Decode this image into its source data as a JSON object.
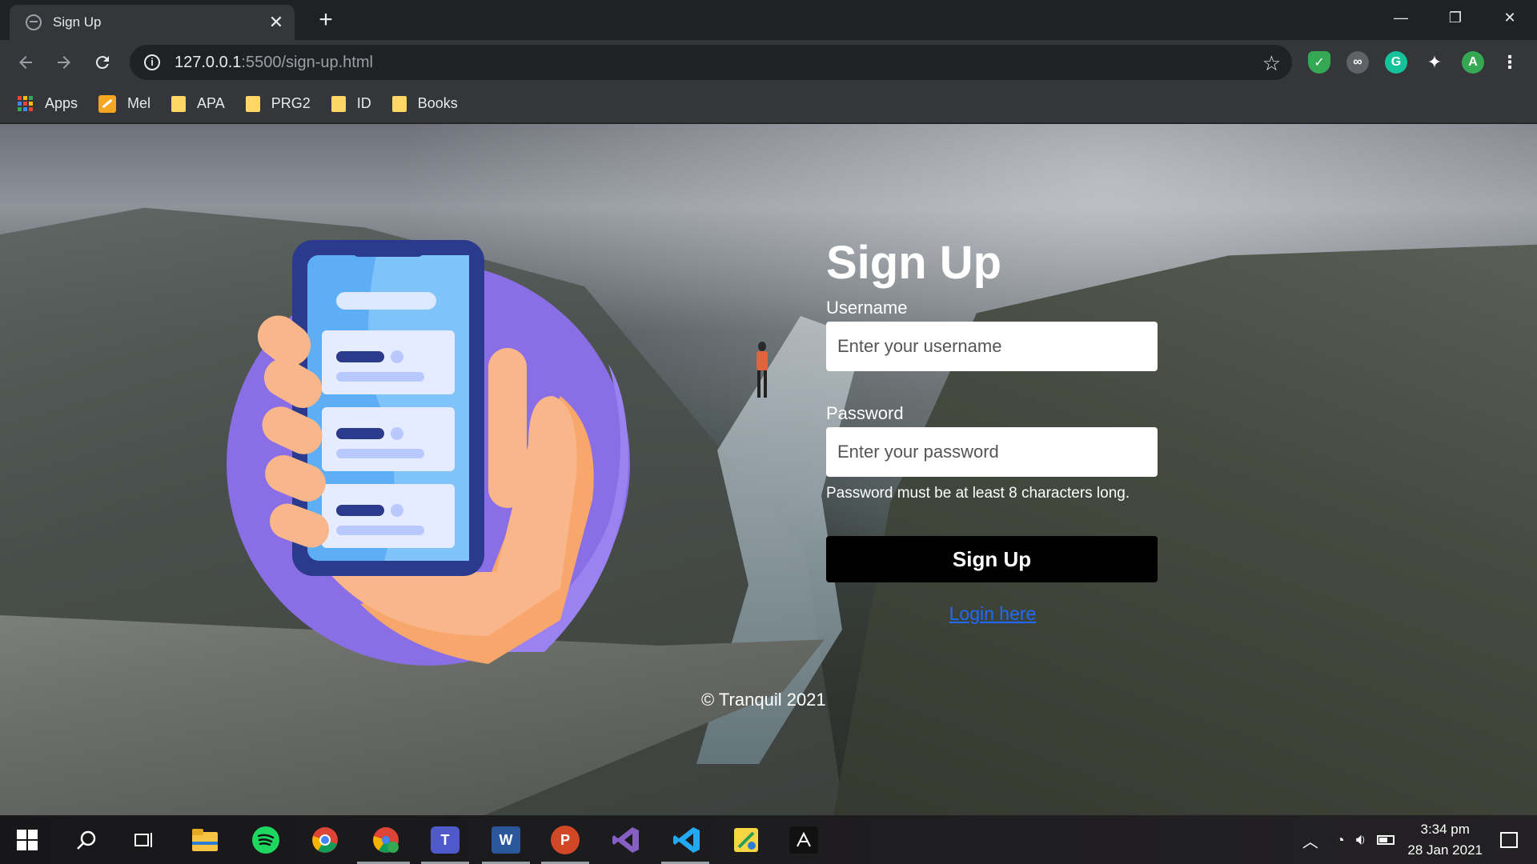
{
  "browser": {
    "tab_title": "Sign Up",
    "tab_close": "✕",
    "new_tab": "+",
    "url_host": "127.0.0.1",
    "url_rest": ":5500/sign-up.html",
    "window_controls": [
      "—",
      "❐",
      "✕"
    ]
  },
  "bookmarks": [
    {
      "label": "Apps",
      "icon": "apps-grid-icon"
    },
    {
      "label": "Mel",
      "icon": "pencil-icon"
    },
    {
      "label": "APA",
      "icon": "folder-icon"
    },
    {
      "label": "PRG2",
      "icon": "folder-icon"
    },
    {
      "label": "ID",
      "icon": "folder-icon"
    },
    {
      "label": "Books",
      "icon": "folder-icon"
    }
  ],
  "extensions": {
    "profile_initial": "A",
    "grammarly_letter": "G"
  },
  "page": {
    "heading": "Sign Up",
    "username_label": "Username",
    "username_placeholder": "Enter your username",
    "password_label": "Password",
    "password_placeholder": "Enter your password",
    "password_hint": "Password must be at least 8 characters long.",
    "submit_label": "Sign Up",
    "login_link": "Login here",
    "footer": "© Tranquil 2021"
  },
  "taskbar": {
    "apps": [
      "start-icon",
      "search-icon",
      "task-view-icon",
      "file-explorer-icon",
      "spotify-icon",
      "chrome-icon",
      "chrome-profile-icon",
      "teams-icon",
      "word-icon",
      "powerpoint-icon",
      "visual-studio-icon",
      "vscode-icon",
      "sticky-app-icon",
      "acrobat-icon"
    ],
    "word_letter": "W",
    "powerpoint_letter": "P",
    "teams_letter": "T",
    "time": "3:34 pm",
    "date": "28 Jan 2021"
  },
  "colors": {
    "link": "#1e6bff",
    "button": "#000000",
    "illustration_circle": "#8a6ee6",
    "phone_frame": "#2b3a8c"
  }
}
